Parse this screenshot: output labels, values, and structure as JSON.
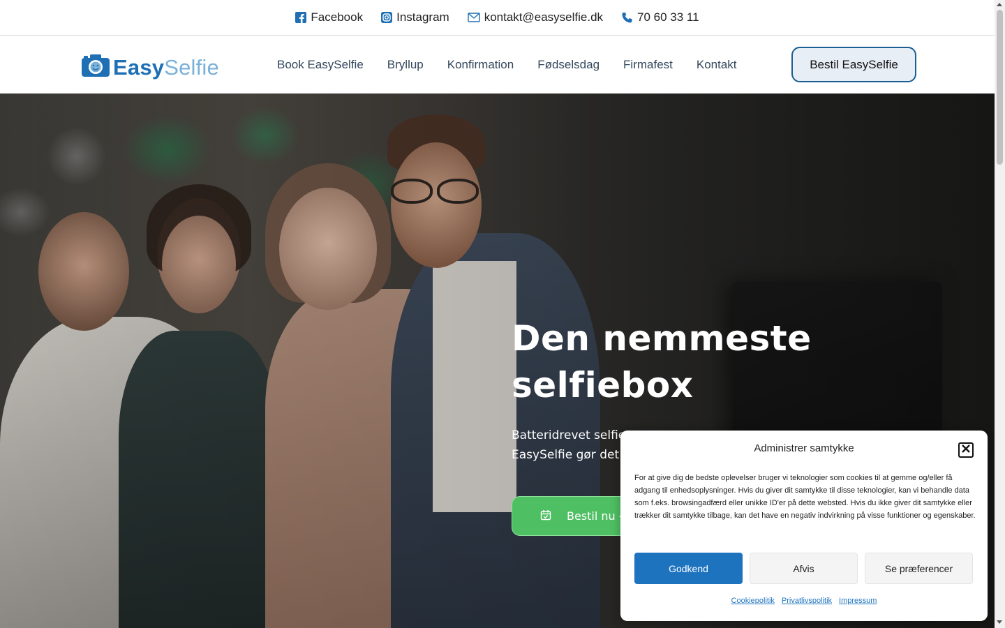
{
  "topbar": {
    "facebook": "Facebook",
    "instagram": "Instagram",
    "email": "kontakt@easyselfie.dk",
    "phone": "70 60 33 11"
  },
  "header": {
    "logo_easy": "Easy",
    "logo_selfie": "Selfie",
    "nav": [
      "Book EasySelfie",
      "Bryllup",
      "Konfirmation",
      "Fødselsdag",
      "Firmafest",
      "Kontakt"
    ],
    "cta": "Bestil EasySelfie"
  },
  "hero": {
    "title_line1": "Den nemmeste",
    "title_line2": "selfiebox",
    "subtitle_line1": "Batteridrevet selfie",
    "subtitle_line2": "EasySelfie gør det",
    "button": "Bestil nu -"
  },
  "cookie": {
    "title": "Administrer samtykke",
    "text": "For at give dig de bedste oplevelser bruger vi teknologier som cookies til at gemme og/eller få adgang til enhedsoplysninger. Hvis du giver dit samtykke til disse teknologier, kan vi behandle data som f.eks. browsingadfærd eller unikke ID'er på dette websted. Hvis du ikke giver dit samtykke eller trækker dit samtykke tilbage, kan det have en negativ indvirkning på visse funktioner og egenskaber.",
    "accept": "Godkend",
    "deny": "Afvis",
    "preferences": "Se præferencer",
    "links": [
      "Cookiepolitik",
      "Privatlivspolitik",
      "Impressum"
    ]
  },
  "colors": {
    "brand_blue": "#1e6fb4",
    "brand_light_blue": "#7ab1d9",
    "cta_green": "#4fbf63",
    "cookie_primary": "#1e73be"
  }
}
